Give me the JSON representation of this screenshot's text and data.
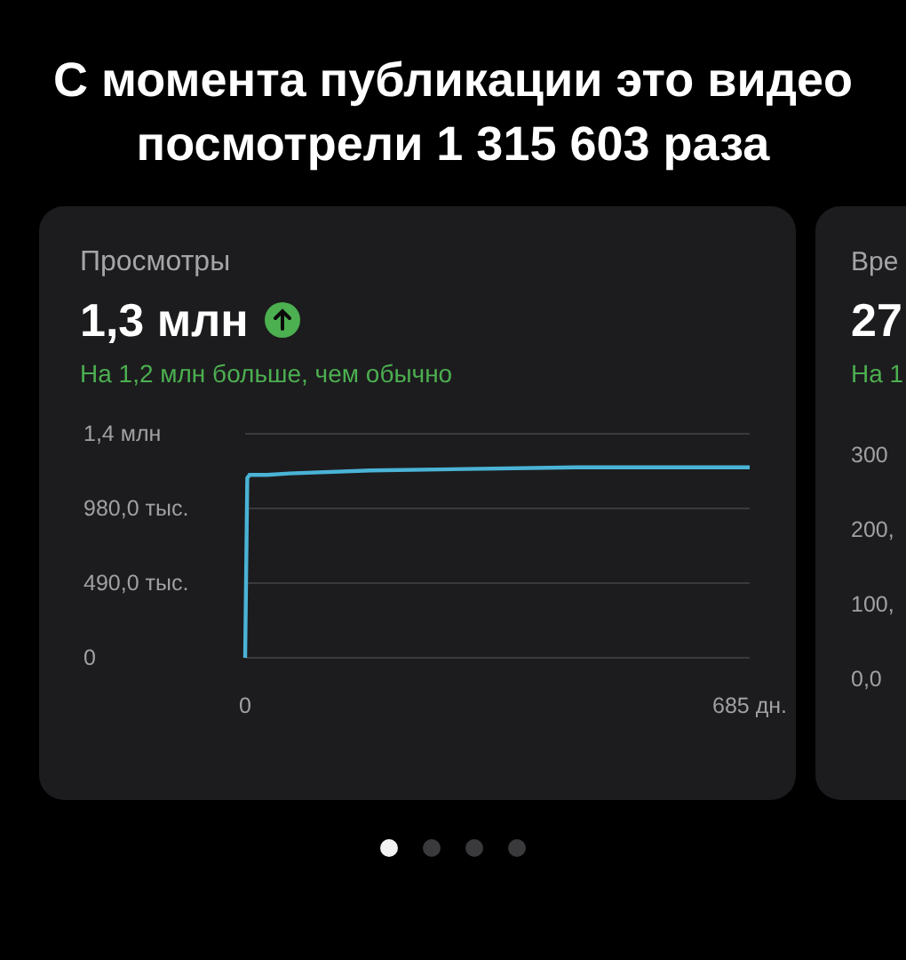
{
  "headline": "С момента публикации это видео посмотрели 1 315 603 раза",
  "cards": [
    {
      "title": "Просмотры",
      "value": "1,3 млн",
      "rising": true,
      "delta": "На 1,2 млн больше, чем обычно",
      "chart_data": {
        "type": "line",
        "x": [
          0,
          3,
          6,
          30,
          60,
          170,
          450,
          685
        ],
        "series": [
          {
            "color": "#4ab3d6",
            "values": [
              0,
              1180,
              1200,
              1200,
              1210,
              1230,
              1250,
              1250
            ]
          }
        ],
        "xlim": [
          0,
          685
        ],
        "ylim": [
          0,
          1470
        ],
        "grid": true,
        "xticks": [
          {
            "value": 0,
            "label": "0"
          },
          {
            "value": 685,
            "label": "685 дн."
          }
        ],
        "yticks": [
          {
            "value": 0,
            "label": "0"
          },
          {
            "value": 490,
            "label": "490,0 тыс."
          },
          {
            "value": 980,
            "label": "980,0 тыс."
          }
        ]
      },
      "axis_top_label": "1,4 млн"
    },
    {
      "title": "Вре",
      "value": "27",
      "delta": "На 1",
      "axis_labels": [
        "300",
        "200,",
        "100,",
        "0,0"
      ]
    }
  ],
  "pager": [
    {
      "selected": true
    },
    {
      "selected": false
    },
    {
      "selected": false
    },
    {
      "selected": false
    }
  ]
}
